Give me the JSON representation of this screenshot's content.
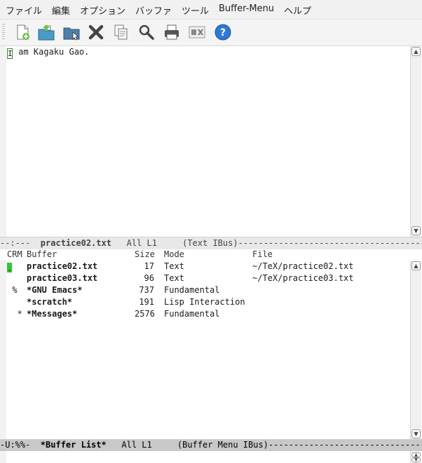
{
  "menubar": {
    "items": [
      "ファイル",
      "編集",
      "オプション",
      "バッファ",
      "ツール",
      "Buffer-Menu",
      "ヘルプ"
    ]
  },
  "toolbar": {
    "buttons": [
      "new-file",
      "open-file",
      "open-directory",
      "kill-buffer",
      "save",
      "search",
      "print",
      "cut",
      "help"
    ]
  },
  "top_window": {
    "text_line": "am Kagaku Gao.",
    "cursor_char": "I"
  },
  "top_modeline": {
    "prefix": "--:---  ",
    "buffer": "practice02.txt",
    "rest": "   All L1     (Text IBus)----------------------------------------------"
  },
  "buffer_list": {
    "headers": {
      "crm": "CRM",
      "buffer": "Buffer",
      "size": "Size",
      "mode": "Mode",
      "file": "File"
    },
    "rows": [
      {
        "crm": ".",
        "name": "practice02.txt",
        "size": "17",
        "mode": "Text",
        "file": "~/TeX/practice02.txt",
        "current": true
      },
      {
        "crm": "",
        "name": "practice03.txt",
        "size": "96",
        "mode": "Text",
        "file": "~/TeX/practice03.txt",
        "current": false
      },
      {
        "crm": " %",
        "name": "*GNU Emacs*",
        "size": "737",
        "mode": "Fundamental",
        "file": "",
        "current": false
      },
      {
        "crm": "",
        "name": "*scratch*",
        "size": "191",
        "mode": "Lisp Interaction",
        "file": "",
        "current": false
      },
      {
        "crm": "  *",
        "name": "*Messages*",
        "size": "2576",
        "mode": "Fundamental",
        "file": "",
        "current": false
      }
    ]
  },
  "bottom_modeline": {
    "prefix": "-U:%%-  ",
    "buffer": "*Buffer List*",
    "rest": "   All L1     (Buffer Menu IBus)----------------------------------------"
  },
  "colors": {
    "cursor": "#32c832",
    "help": "#2f78d4"
  }
}
